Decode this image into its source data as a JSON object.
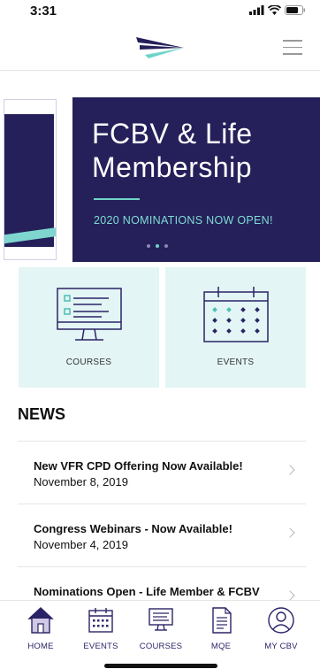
{
  "status": {
    "time": "3:31"
  },
  "banner": {
    "title_line1": "FCBV & Life",
    "title_line2": "Membership",
    "subtitle": "2020 NOMINATIONS NOW OPEN!"
  },
  "tiles": {
    "courses_label": "COURSES",
    "events_label": "EVENTS"
  },
  "news": {
    "heading": "NEWS",
    "items": [
      {
        "title": "New VFR CPD Offering Now Available!",
        "date": "November 8, 2019"
      },
      {
        "title": "Congress Webinars - Now Available!",
        "date": "November 4, 2019"
      },
      {
        "title": "Nominations Open - Life Member & FCBV",
        "date": ""
      }
    ]
  },
  "tabs": [
    {
      "label": "HOME",
      "icon": "home-icon"
    },
    {
      "label": "EVENTS",
      "icon": "calendar-icon"
    },
    {
      "label": "COURSES",
      "icon": "monitor-icon"
    },
    {
      "label": "MQE",
      "icon": "document-icon"
    },
    {
      "label": "MY CBV",
      "icon": "user-icon"
    }
  ],
  "colors": {
    "brand_navy": "#25205a",
    "accent_teal": "#6fd4c9",
    "tile_bg": "#e3f5f4"
  }
}
